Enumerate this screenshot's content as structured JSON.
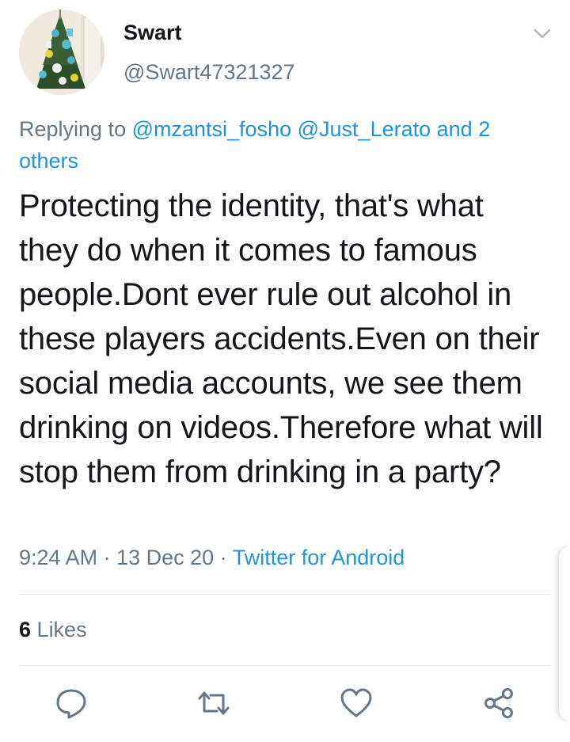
{
  "user": {
    "name": "Swart",
    "handle": "@Swart47321327"
  },
  "reply": {
    "prefix": "Replying to",
    "mention_1": "@mzantsi_fosho",
    "mention_2": "@Just_Lerato",
    "others": "and 2 others"
  },
  "tweet": {
    "text": "Protecting the identity, that's what they do when it comes to famous people.Dont ever rule out alcohol in these players accidents.Even on their social media accounts, we see them drinking on videos.Therefore what will stop them from drinking in a party?"
  },
  "meta": {
    "time": "9:24 AM",
    "sep": "·",
    "date": "13 Dec 20",
    "source": "Twitter for Android"
  },
  "stats": {
    "likes_count": "6",
    "likes_label": "Likes"
  },
  "icons": {
    "menu": "chevron-down-icon",
    "reply": "reply-icon",
    "retweet": "retweet-icon",
    "like": "heart-icon",
    "share": "share-icon"
  },
  "colors": {
    "link": "#1b95e0",
    "muted": "#657786",
    "text": "#14171a",
    "divider": "#e1e8ed"
  }
}
